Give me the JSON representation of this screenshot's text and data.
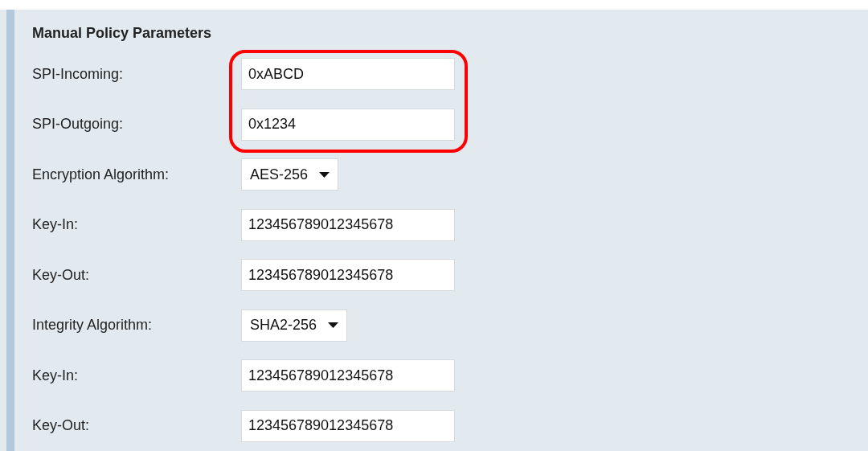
{
  "section": {
    "title": "Manual Policy Parameters"
  },
  "rows": [
    {
      "kind": "text",
      "label": "SPI-Incoming:",
      "value": "0xABCD",
      "highlighted": true
    },
    {
      "kind": "text",
      "label": "SPI-Outgoing:",
      "value": "0x1234",
      "highlighted": true
    },
    {
      "kind": "select",
      "label": "Encryption Algorithm:",
      "value": "AES-256",
      "highlighted": false
    },
    {
      "kind": "text",
      "label": "Key-In:",
      "value": "123456789012345678",
      "highlighted": false
    },
    {
      "kind": "text",
      "label": "Key-Out:",
      "value": "123456789012345678",
      "highlighted": false
    },
    {
      "kind": "select",
      "label": "Integrity Algorithm:",
      "value": "SHA2-256",
      "highlighted": false
    },
    {
      "kind": "text",
      "label": "Key-In:",
      "value": "123456789012345678",
      "highlighted": false
    },
    {
      "kind": "text",
      "label": "Key-Out:",
      "value": "123456789012345678",
      "highlighted": false
    }
  ]
}
